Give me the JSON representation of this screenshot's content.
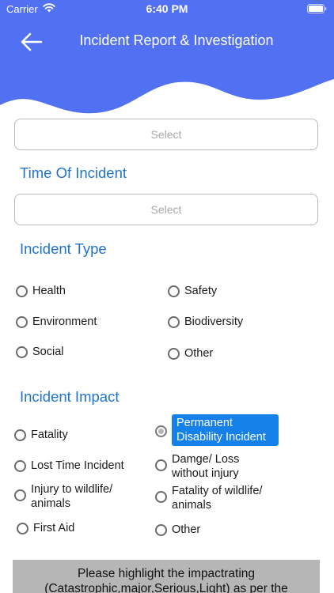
{
  "status": {
    "carrier": "Carrier",
    "time": "6:40 PM"
  },
  "header": {
    "title": "Incident Report & Investigation",
    "color": "#5170f2",
    "back_icon": "back-arrow-icon"
  },
  "fields": {
    "top_select": {
      "placeholder": "Select"
    },
    "time_of_incident": {
      "label": "Time Of Incident",
      "placeholder": "Select"
    }
  },
  "incident_type": {
    "title": "Incident Type",
    "options": [
      {
        "label": "Health",
        "selected": false
      },
      {
        "label": "Safety",
        "selected": false
      },
      {
        "label": "Environment",
        "selected": false
      },
      {
        "label": "Biodiversity",
        "selected": false
      },
      {
        "label": "Social",
        "selected": false
      },
      {
        "label": "Other",
        "selected": false
      }
    ]
  },
  "incident_impact": {
    "title": "Incident Impact",
    "options": [
      {
        "label": "Fatality",
        "selected": false
      },
      {
        "label": "Permanent Disability Incident",
        "selected": true
      },
      {
        "label": "Lost Time Incident",
        "selected": false
      },
      {
        "label": "Damge/ Loss without injury",
        "selected": false
      },
      {
        "label": "Injury to wildlife/ animals",
        "selected": false
      },
      {
        "label": "Fatality of wildlife/ animals",
        "selected": false
      },
      {
        "label": "First Aid",
        "selected": false
      },
      {
        "label": "Other",
        "selected": false
      }
    ]
  },
  "footer": {
    "note": "Please highlight the impactrating (Catastrophic,major,Serious,Light) as per the"
  },
  "colors": {
    "accent": "#1f73c9",
    "highlight": "#1480e8",
    "header": "#5170f2"
  }
}
